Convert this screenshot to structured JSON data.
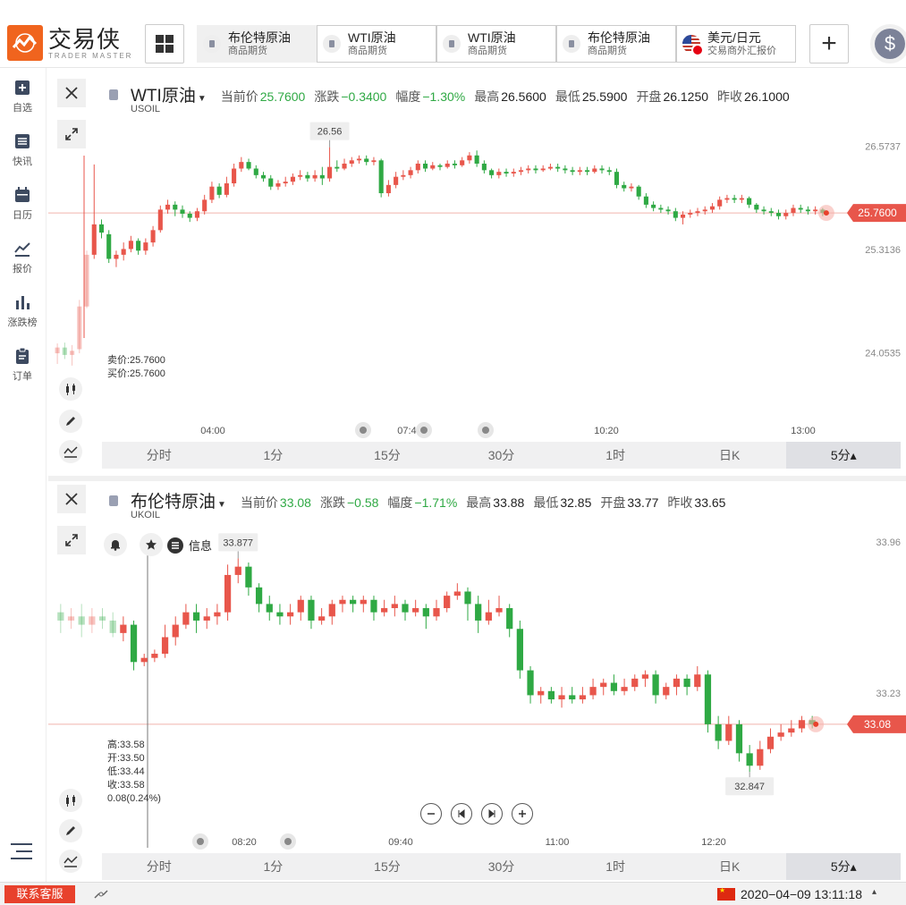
{
  "app": {
    "logo_cn": "交易侠",
    "logo_en": "TRADER MASTER"
  },
  "tabs": [
    {
      "title": "布伦特原油",
      "sub": "商品期货"
    },
    {
      "title": "WTI原油",
      "sub": "商品期货"
    },
    {
      "title": "WTI原油",
      "sub": "商品期货"
    },
    {
      "title": "布伦特原油",
      "sub": "商品期货"
    },
    {
      "title": "美元/日元",
      "sub": "交易商外汇报价"
    }
  ],
  "add_label": "+",
  "dollar_label": "$",
  "sidebar": {
    "items": [
      {
        "label": "自选",
        "icon": "plus-square-icon"
      },
      {
        "label": "快讯",
        "icon": "list-icon"
      },
      {
        "label": "日历",
        "icon": "calendar-icon"
      },
      {
        "label": "报价",
        "icon": "trend-icon"
      },
      {
        "label": "涨跌榜",
        "icon": "bar-chart-icon"
      },
      {
        "label": "订单",
        "icon": "clipboard-icon"
      }
    ]
  },
  "colors": {
    "up": "#e8564b",
    "down": "#2fa944",
    "price_line": "#f0b4ae",
    "accent": "#f0641e"
  },
  "timeframes": [
    "分时",
    "1分",
    "15分",
    "30分",
    "1时",
    "日K",
    "5分▴"
  ],
  "panel1": {
    "name": "WTI原油",
    "code": "USOIL",
    "quote": {
      "current_label": "当前价",
      "current": "25.7600",
      "change_label": "涨跌",
      "change": "−0.3400",
      "pct_label": "幅度",
      "pct": "−1.30%",
      "high_label": "最高",
      "high": "26.5600",
      "low_label": "最低",
      "low": "25.5900",
      "open_label": "开盘",
      "open": "26.1250",
      "prev_label": "昨收",
      "prev": "26.1000"
    },
    "sell": "卖价:25.7600",
    "buy": "买价:25.7600",
    "peak_label": "26.56",
    "price_tag": "25.7600",
    "chart_data": {
      "type": "candlestick",
      "y_ticks": [
        "26.5737",
        "25.3136",
        "24.0535"
      ],
      "x_ticks": [
        "04:00",
        "07:40",
        "10:20",
        "13:00"
      ],
      "ylim": [
        23.8,
        26.85
      ],
      "current": 25.76,
      "high": 26.56,
      "candles": [
        [
          24.05,
          24.12,
          23.92,
          24.17
        ],
        [
          24.12,
          24.03,
          23.98,
          24.18
        ],
        [
          24.03,
          24.08,
          23.9,
          24.15
        ],
        [
          24.1,
          24.62,
          24.05,
          24.7
        ],
        [
          24.62,
          25.25,
          24.6,
          25.3
        ],
        [
          25.25,
          25.62,
          25.2,
          26.35
        ],
        [
          25.62,
          25.52,
          25.45,
          25.68
        ],
        [
          25.5,
          25.2,
          25.15,
          25.55
        ],
        [
          25.2,
          25.25,
          25.1,
          25.3
        ],
        [
          25.25,
          25.32,
          25.18,
          25.4
        ],
        [
          25.32,
          25.42,
          25.28,
          25.48
        ],
        [
          25.42,
          25.3,
          25.25,
          25.45
        ],
        [
          25.3,
          25.4,
          25.25,
          25.45
        ],
        [
          25.4,
          25.55,
          25.35,
          25.6
        ],
        [
          25.55,
          25.8,
          25.52,
          25.85
        ],
        [
          25.8,
          25.86,
          25.75,
          25.92
        ],
        [
          25.86,
          25.8,
          25.72,
          25.9
        ],
        [
          25.8,
          25.75,
          25.7,
          25.85
        ],
        [
          25.75,
          25.7,
          25.65,
          25.78
        ],
        [
          25.7,
          25.78,
          25.66,
          25.82
        ],
        [
          25.78,
          25.92,
          25.74,
          25.98
        ],
        [
          25.92,
          26.08,
          25.88,
          26.14
        ],
        [
          26.08,
          25.98,
          25.94,
          26.12
        ],
        [
          25.98,
          26.12,
          25.95,
          26.2
        ],
        [
          26.12,
          26.3,
          26.08,
          26.36
        ],
        [
          26.3,
          26.38,
          26.26,
          26.44
        ],
        [
          26.38,
          26.3,
          26.28,
          26.42
        ],
        [
          26.3,
          26.22,
          26.18,
          26.34
        ],
        [
          26.22,
          26.18,
          26.14,
          26.26
        ],
        [
          26.18,
          26.08,
          26.04,
          26.22
        ],
        [
          26.08,
          26.12,
          26.04,
          26.16
        ],
        [
          26.12,
          26.14,
          26.08,
          26.2
        ],
        [
          26.14,
          26.2,
          26.1,
          26.24
        ],
        [
          26.2,
          26.22,
          26.16,
          26.28
        ],
        [
          26.22,
          26.18,
          26.14,
          26.26
        ],
        [
          26.18,
          26.22,
          26.14,
          26.28
        ],
        [
          26.22,
          26.18,
          26.1,
          26.32
        ],
        [
          26.18,
          26.32,
          26.14,
          26.56
        ],
        [
          26.32,
          26.3,
          26.26,
          26.4
        ],
        [
          26.3,
          26.36,
          26.28,
          26.42
        ],
        [
          26.36,
          26.4,
          26.32,
          26.44
        ],
        [
          26.4,
          26.42,
          26.36,
          26.46
        ],
        [
          26.42,
          26.38,
          26.34,
          26.46
        ],
        [
          26.38,
          26.4,
          26.34,
          26.44
        ],
        [
          26.4,
          26.0,
          25.95,
          26.42
        ],
        [
          26.0,
          26.1,
          25.96,
          26.16
        ],
        [
          26.1,
          26.2,
          26.06,
          26.26
        ],
        [
          26.2,
          26.22,
          26.16,
          26.28
        ],
        [
          26.22,
          26.28,
          26.18,
          26.32
        ],
        [
          26.28,
          26.36,
          26.24,
          26.4
        ],
        [
          26.36,
          26.3,
          26.26,
          26.4
        ],
        [
          26.3,
          26.34,
          26.28,
          26.38
        ],
        [
          26.34,
          26.32,
          26.28,
          26.36
        ],
        [
          26.32,
          26.36,
          26.3,
          26.4
        ],
        [
          26.36,
          26.34,
          26.3,
          26.4
        ],
        [
          26.34,
          26.4,
          26.32,
          26.44
        ],
        [
          26.4,
          26.46,
          26.36,
          26.5
        ],
        [
          26.46,
          26.36,
          26.32,
          26.52
        ],
        [
          26.36,
          26.28,
          26.24,
          26.4
        ],
        [
          26.28,
          26.22,
          26.18,
          26.3
        ],
        [
          26.22,
          26.26,
          26.18,
          26.3
        ],
        [
          26.26,
          26.24,
          26.2,
          26.3
        ],
        [
          26.24,
          26.26,
          26.2,
          26.3
        ],
        [
          26.26,
          26.28,
          26.22,
          26.32
        ],
        [
          26.28,
          26.3,
          26.24,
          26.34
        ],
        [
          26.3,
          26.28,
          26.24,
          26.34
        ],
        [
          26.28,
          26.3,
          26.26,
          26.34
        ],
        [
          26.3,
          26.32,
          26.28,
          26.36
        ],
        [
          26.32,
          26.3,
          26.26,
          26.36
        ],
        [
          26.3,
          26.28,
          26.24,
          26.34
        ],
        [
          26.28,
          26.26,
          26.22,
          26.32
        ],
        [
          26.26,
          26.28,
          26.22,
          26.32
        ],
        [
          26.28,
          26.26,
          26.22,
          26.32
        ],
        [
          26.26,
          26.3,
          26.24,
          26.34
        ],
        [
          26.3,
          26.28,
          26.24,
          26.34
        ],
        [
          26.28,
          26.26,
          26.22,
          26.32
        ],
        [
          26.26,
          26.1,
          26.06,
          26.3
        ],
        [
          26.1,
          26.06,
          26.02,
          26.14
        ],
        [
          26.06,
          26.08,
          26.02,
          26.12
        ],
        [
          26.08,
          25.96,
          25.92,
          26.1
        ],
        [
          25.96,
          25.86,
          25.82,
          26.0
        ],
        [
          25.86,
          25.82,
          25.78,
          25.9
        ],
        [
          25.82,
          25.8,
          25.76,
          25.86
        ],
        [
          25.8,
          25.78,
          25.74,
          25.84
        ],
        [
          25.78,
          25.7,
          25.66,
          25.82
        ],
        [
          25.7,
          25.74,
          25.62,
          25.78
        ],
        [
          25.74,
          25.76,
          25.7,
          25.8
        ],
        [
          25.76,
          25.78,
          25.72,
          25.82
        ],
        [
          25.78,
          25.8,
          25.74,
          25.84
        ],
        [
          25.8,
          25.84,
          25.76,
          25.88
        ],
        [
          25.84,
          25.92,
          25.8,
          25.96
        ],
        [
          25.92,
          25.94,
          25.88,
          25.98
        ],
        [
          25.94,
          25.92,
          25.88,
          25.98
        ],
        [
          25.92,
          25.94,
          25.88,
          25.98
        ],
        [
          25.94,
          25.86,
          25.82,
          25.96
        ],
        [
          25.86,
          25.8,
          25.76,
          25.88
        ],
        [
          25.8,
          25.78,
          25.74,
          25.84
        ],
        [
          25.78,
          25.76,
          25.72,
          25.82
        ],
        [
          25.76,
          25.72,
          25.68,
          25.8
        ],
        [
          25.72,
          25.76,
          25.68,
          25.8
        ],
        [
          25.76,
          25.82,
          25.72,
          25.86
        ],
        [
          25.82,
          25.8,
          25.76,
          25.86
        ],
        [
          25.8,
          25.78,
          25.74,
          25.84
        ],
        [
          25.78,
          25.8,
          25.74,
          25.84
        ],
        [
          25.8,
          25.76,
          25.72,
          25.82
        ]
      ]
    }
  },
  "panel2": {
    "name": "布伦特原油",
    "code": "UKOIL",
    "quote": {
      "current_label": "当前价",
      "current": "33.08",
      "change_label": "涨跌",
      "change": "−0.58",
      "pct_label": "幅度",
      "pct": "−1.71%",
      "high_label": "最高",
      "high": "33.88",
      "low_label": "最低",
      "low": "32.85",
      "open_label": "开盘",
      "open": "33.77",
      "prev_label": "昨收",
      "prev": "33.65"
    },
    "info_label": "信息",
    "ohlc": {
      "high": "高:33.58",
      "open": "开:33.50",
      "low": "低:33.44",
      "close": "收:33.58",
      "change": "0.08(0.24%)"
    },
    "max_label": "33.877",
    "min_label": "32.847",
    "price_tag": "33.08",
    "chart_data": {
      "type": "candlestick",
      "y_ticks": [
        "33.96",
        "33.23"
      ],
      "x_ticks": [
        "08:20",
        "09:40",
        "11:00",
        "12:20"
      ],
      "ylim": [
        32.7,
        34.08
      ],
      "current": 33.08,
      "high": 33.877,
      "low": 32.847,
      "candles": [
        [
          33.62,
          33.58,
          33.52,
          33.66
        ],
        [
          33.58,
          33.6,
          33.54,
          33.64
        ],
        [
          33.6,
          33.56,
          33.5,
          33.66
        ],
        [
          33.56,
          33.6,
          33.52,
          33.64
        ],
        [
          33.6,
          33.58,
          33.54,
          33.64
        ],
        [
          33.58,
          33.52,
          33.5,
          33.62
        ],
        [
          33.52,
          33.56,
          33.48,
          33.6
        ],
        [
          33.56,
          33.38,
          33.34,
          33.58
        ],
        [
          33.38,
          33.4,
          33.36,
          33.42
        ],
        [
          33.4,
          33.42,
          33.38,
          33.44
        ],
        [
          33.42,
          33.5,
          33.4,
          33.56
        ],
        [
          33.5,
          33.56,
          33.46,
          33.6
        ],
        [
          33.56,
          33.62,
          33.54,
          33.66
        ],
        [
          33.62,
          33.58,
          33.52,
          33.66
        ],
        [
          33.58,
          33.6,
          33.54,
          33.64
        ],
        [
          33.6,
          33.62,
          33.56,
          33.66
        ],
        [
          33.62,
          33.8,
          33.58,
          33.85
        ],
        [
          33.8,
          33.84,
          33.76,
          33.88
        ],
        [
          33.84,
          33.74,
          33.7,
          33.86
        ],
        [
          33.74,
          33.66,
          33.62,
          33.76
        ],
        [
          33.66,
          33.62,
          33.58,
          33.7
        ],
        [
          33.62,
          33.6,
          33.56,
          33.66
        ],
        [
          33.6,
          33.62,
          33.56,
          33.66
        ],
        [
          33.62,
          33.68,
          33.58,
          33.7
        ],
        [
          33.68,
          33.58,
          33.54,
          33.7
        ],
        [
          33.58,
          33.6,
          33.56,
          33.64
        ],
        [
          33.6,
          33.66,
          33.56,
          33.68
        ],
        [
          33.66,
          33.68,
          33.62,
          33.7
        ],
        [
          33.68,
          33.66,
          33.62,
          33.7
        ],
        [
          33.66,
          33.68,
          33.62,
          33.7
        ],
        [
          33.68,
          33.62,
          33.58,
          33.7
        ],
        [
          33.62,
          33.64,
          33.6,
          33.68
        ],
        [
          33.64,
          33.66,
          33.6,
          33.7
        ],
        [
          33.66,
          33.62,
          33.58,
          33.68
        ],
        [
          33.62,
          33.64,
          33.6,
          33.68
        ],
        [
          33.64,
          33.6,
          33.54,
          33.66
        ],
        [
          33.6,
          33.64,
          33.58,
          33.68
        ],
        [
          33.64,
          33.7,
          33.62,
          33.72
        ],
        [
          33.7,
          33.72,
          33.68,
          33.76
        ],
        [
          33.72,
          33.66,
          33.58,
          33.74
        ],
        [
          33.66,
          33.58,
          33.52,
          33.7
        ],
        [
          33.58,
          33.62,
          33.56,
          33.68
        ],
        [
          33.62,
          33.64,
          33.6,
          33.7
        ],
        [
          33.64,
          33.54,
          33.5,
          33.66
        ],
        [
          33.54,
          33.34,
          33.3,
          33.58
        ],
        [
          33.34,
          33.22,
          33.18,
          33.36
        ],
        [
          33.22,
          33.24,
          33.18,
          33.26
        ],
        [
          33.24,
          33.2,
          33.18,
          33.26
        ],
        [
          33.2,
          33.22,
          33.16,
          33.26
        ],
        [
          33.22,
          33.2,
          33.18,
          33.26
        ],
        [
          33.2,
          33.22,
          33.18,
          33.26
        ],
        [
          33.22,
          33.26,
          33.2,
          33.3
        ],
        [
          33.26,
          33.28,
          33.22,
          33.3
        ],
        [
          33.28,
          33.24,
          33.22,
          33.32
        ],
        [
          33.24,
          33.26,
          33.22,
          33.3
        ],
        [
          33.26,
          33.3,
          33.24,
          33.32
        ],
        [
          33.3,
          33.32,
          33.26,
          33.34
        ],
        [
          33.32,
          33.22,
          33.18,
          33.34
        ],
        [
          33.22,
          33.26,
          33.2,
          33.28
        ],
        [
          33.26,
          33.3,
          33.22,
          33.32
        ],
        [
          33.3,
          33.26,
          33.22,
          33.32
        ],
        [
          33.26,
          33.32,
          33.24,
          33.36
        ],
        [
          33.32,
          33.08,
          33.04,
          33.34
        ],
        [
          33.08,
          33.0,
          32.96,
          33.12
        ],
        [
          33.0,
          33.08,
          32.98,
          33.12
        ],
        [
          33.08,
          32.94,
          32.9,
          33.1
        ],
        [
          32.94,
          32.88,
          32.85,
          32.98
        ],
        [
          32.88,
          32.96,
          32.86,
          33.0
        ],
        [
          32.96,
          33.02,
          32.94,
          33.06
        ],
        [
          33.02,
          33.04,
          33.0,
          33.08
        ],
        [
          33.04,
          33.06,
          33.02,
          33.1
        ],
        [
          33.06,
          33.1,
          33.04,
          33.12
        ],
        [
          33.1,
          33.08,
          33.06,
          33.12
        ]
      ]
    }
  },
  "status": {
    "cs_label": "联系客服",
    "datetime": "2020−04−09 13:11:18",
    "tri": "▴"
  }
}
